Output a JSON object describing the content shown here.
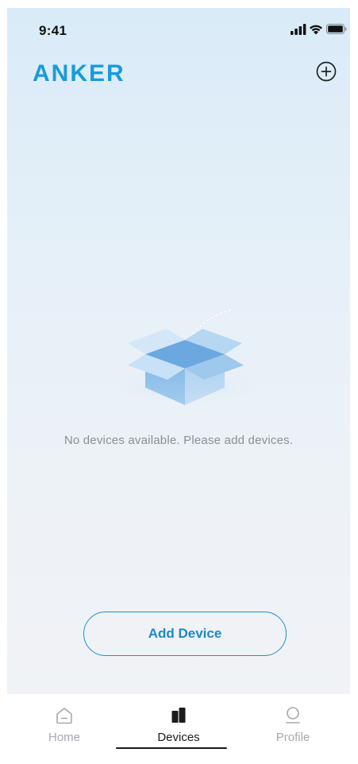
{
  "status_bar": {
    "time": "9:41"
  },
  "header": {
    "brand": "ANKER",
    "add_icon": "plus-circle-icon"
  },
  "empty_state": {
    "illustration": "open-box-icon",
    "message": "No devices available. Please add devices."
  },
  "actions": {
    "add_device_label": "Add Device"
  },
  "tab_bar": {
    "items": [
      {
        "label": "Home",
        "icon": "home-icon",
        "active": false
      },
      {
        "label": "Devices",
        "icon": "devices-icon",
        "active": true
      },
      {
        "label": "Profile",
        "icon": "profile-icon",
        "active": false
      }
    ]
  },
  "colors": {
    "brand": "#1a9bd8",
    "accent": "#1f8fc9",
    "inactive_tab": "#a5a9ae",
    "active_tab": "#1c1c1e",
    "message_text": "#8a8f96"
  }
}
